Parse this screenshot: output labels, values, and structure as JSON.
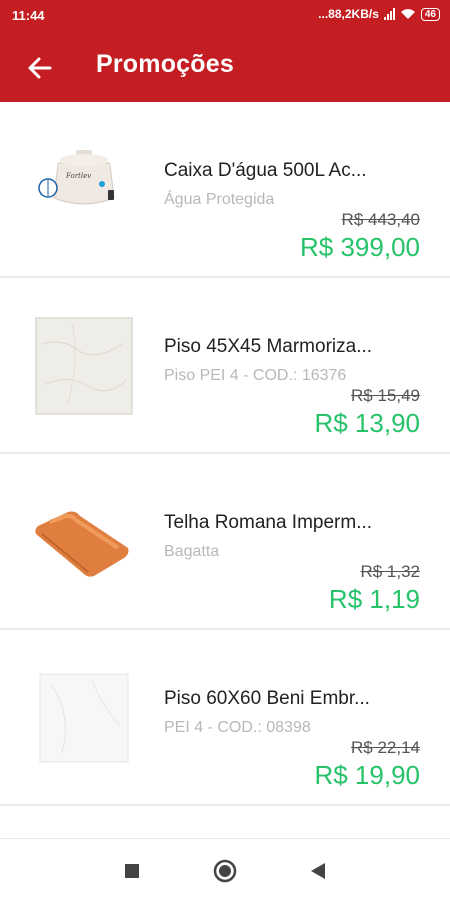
{
  "status_bar": {
    "time": "11:44",
    "network_speed": "...88,2KB/s",
    "battery": "46"
  },
  "header": {
    "title": "Promoções",
    "back_icon": "arrow-left-icon"
  },
  "products": [
    {
      "name": "Caixa D'água 500L Ac...",
      "subtitle": "Água Protegida",
      "old_price": "R$ 443,40",
      "new_price": "R$ 399,00",
      "image": "water-tank-image"
    },
    {
      "name": "Piso 45X45 Marmoriza...",
      "subtitle": "Piso PEI 4 - COD.: 16376",
      "old_price": "R$ 15,49",
      "new_price": "R$ 13,90",
      "image": "marble-tile-image"
    },
    {
      "name": "Telha Romana Imperm...",
      "subtitle": "Bagatta",
      "old_price": "R$ 1,32",
      "new_price": "R$ 1,19",
      "image": "roof-tile-image"
    },
    {
      "name": "Piso 60X60 Beni Embr...",
      "subtitle": "PEI 4 - COD.: 08398",
      "old_price": "R$ 22,14",
      "new_price": "R$ 19,90",
      "image": "white-tile-image"
    }
  ],
  "colors": {
    "primary": "#c41e22",
    "price_green": "#27c36a",
    "subtitle_grey": "#b8b8b8"
  },
  "nav_bar": {
    "icons": [
      "square-icon",
      "circle-icon",
      "triangle-back-icon"
    ]
  }
}
